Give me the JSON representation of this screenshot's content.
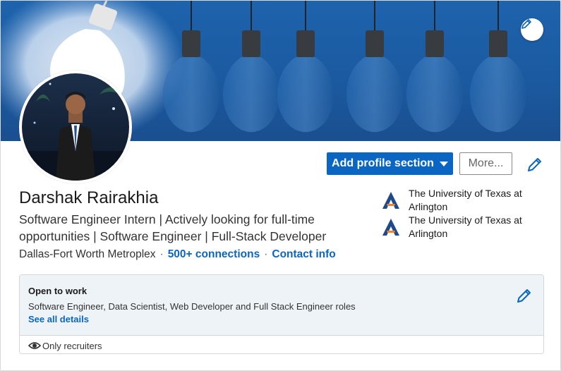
{
  "profile": {
    "name": "Darshak Rairakhia",
    "headline": "Software Engineer Intern | Actively looking for full-time opportunities | Software Engineer | Full-Stack Developer",
    "location": "Dallas-Fort Worth Metroplex",
    "connections": "500+ connections",
    "contact_info": "Contact info"
  },
  "actions": {
    "add_section_label": "Add profile section",
    "more_label": "More..."
  },
  "education": [
    {
      "school": "The University of Texas at Arlington"
    },
    {
      "school": "The University of Texas at Arlington"
    }
  ],
  "open_to_work": {
    "title": "Open to work",
    "roles": "Software Engineer, Data Scientist, Web Developer and Full Stack Engineer roles",
    "details_link": "See all details",
    "visibility": "Only recruiters"
  },
  "colors": {
    "accent": "#0a66c2",
    "banner": "#1b5aa0",
    "otw_background": "#eef3f8"
  },
  "icons": {
    "banner_edit": "pencil-icon",
    "intro_edit": "pencil-icon",
    "otw_edit": "pencil-icon",
    "dropdown": "caret-down-icon",
    "visibility": "eye-icon",
    "school_logo": "uta-logo"
  }
}
